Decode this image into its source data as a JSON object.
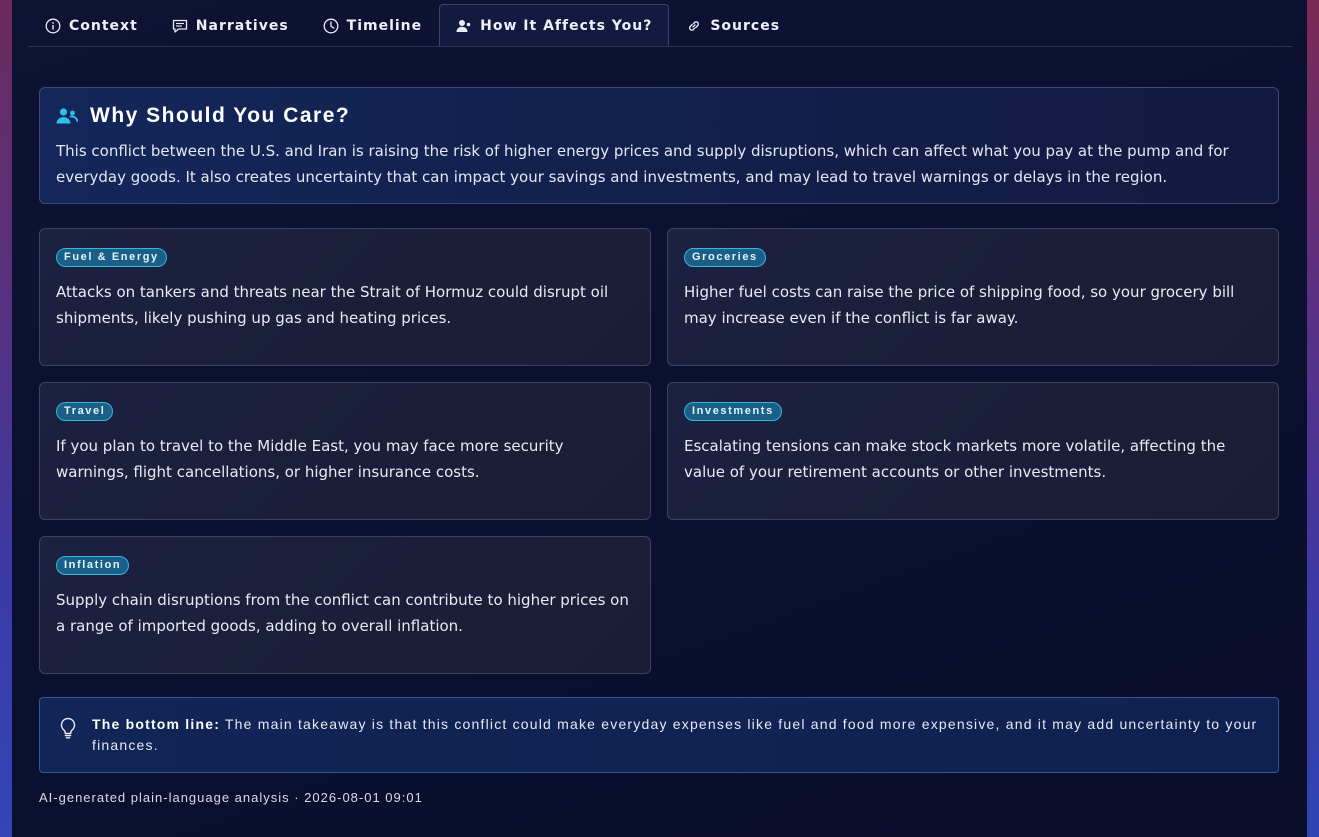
{
  "tabs": [
    {
      "label": "Context",
      "icon": "info-icon"
    },
    {
      "label": "Narratives",
      "icon": "chat-icon"
    },
    {
      "label": "Timeline",
      "icon": "clock-icon"
    },
    {
      "label": "How It Affects You?",
      "icon": "user-icon"
    },
    {
      "label": "Sources",
      "icon": "link-icon"
    }
  ],
  "active_tab": "How It Affects You?",
  "care": {
    "title": "Why Should You Care?",
    "text": "This conflict between the U.S. and Iran is raising the risk of higher energy prices and supply disruptions, which can affect what you pay at the pump and for everyday goods. It also creates uncertainty that can impact your savings and investments, and may lead to travel warnings or delays in the region."
  },
  "cards": [
    {
      "tag": "Fuel & Energy",
      "text": "Attacks on tankers and threats near the Strait of Hormuz could disrupt oil shipments, likely pushing up gas and heating prices."
    },
    {
      "tag": "Groceries",
      "text": "Higher fuel costs can raise the price of shipping food, so your grocery bill may increase even if the conflict is far away."
    },
    {
      "tag": "Travel",
      "text": "If you plan to travel to the Middle East, you may face more security warnings, flight cancellations, or higher insurance costs."
    },
    {
      "tag": "Investments",
      "text": "Escalating tensions can make stock markets more volatile, affecting the value of your retirement accounts or other investments."
    },
    {
      "tag": "Inflation",
      "text": "Supply chain disruptions from the conflict can contribute to higher prices on a range of imported goods, adding to overall inflation."
    }
  ],
  "bottom_line": {
    "label": "The bottom line:",
    "text": " The main takeaway is that this conflict could make everyday expenses like fuel and food more expensive, and it may add uncertainty to your finances."
  },
  "footer": "AI-generated plain-language analysis · 2026-08-01 09:01",
  "colors": {
    "accent": "#2fb8e0",
    "background": "#0b0f2a",
    "tag_bg": "#1c5f86"
  }
}
